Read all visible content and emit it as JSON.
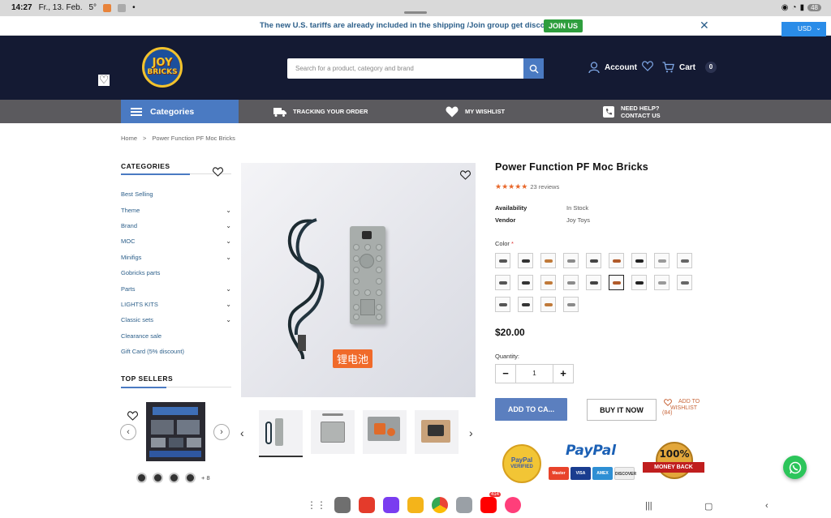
{
  "status_bar": {
    "time": "14:27",
    "date": "Fr., 13. Feb.",
    "temperature": "5°",
    "battery": "48"
  },
  "promo": {
    "text": "The new U.S. tariffs are already included in the shipping /Join group get discount",
    "join_label": "JOIN US",
    "close_icon": "close-icon"
  },
  "currency": {
    "selected": "USD"
  },
  "header": {
    "logo_line1": "JOY",
    "logo_line2": "BRICKS",
    "search_placeholder": "Search for a product, category and brand",
    "account_label": "Account",
    "cart_label": "Cart",
    "cart_count": "0"
  },
  "nav": {
    "categories_label": "Categories",
    "tracking_label": "TRACKING YOUR ORDER",
    "wishlist_label": "MY WISHLIST",
    "help_line1": "NEED HELP?",
    "help_line2": "CONTACT US"
  },
  "breadcrumb": {
    "home": "Home",
    "separator": ">",
    "current": "Power Function PF Moc Bricks"
  },
  "sidebar": {
    "categories_title": "CATEGORIES",
    "items": [
      {
        "label": "Best Selling",
        "expandable": false
      },
      {
        "label": "Theme",
        "expandable": true
      },
      {
        "label": "Brand",
        "expandable": true
      },
      {
        "label": "MOC",
        "expandable": true
      },
      {
        "label": "Minifigs",
        "expandable": true
      },
      {
        "label": "Gobricks parts",
        "expandable": false
      },
      {
        "label": "Parts",
        "expandable": true
      },
      {
        "label": "LIGHTS KITS",
        "expandable": true
      },
      {
        "label": "Classic sets",
        "expandable": true
      },
      {
        "label": "Clearance sale",
        "expandable": false
      },
      {
        "label": "Gift Card (5% discount)",
        "expandable": false
      }
    ],
    "top_sellers_title": "TOP SELLERS",
    "more_swatches": "+ 8"
  },
  "gallery": {
    "image_label": "锂电池",
    "thumb_prev": "‹",
    "thumb_next": "›"
  },
  "product": {
    "title": "Power Function PF Moc Bricks",
    "rating": 4.5,
    "stars": "★★★★★",
    "reviews": "23 reviews",
    "availability_label": "Availability",
    "availability_value": "In Stock",
    "vendor_label": "Vendor",
    "vendor_value": "Joy Toys",
    "color_label": "Color",
    "required_mark": "*",
    "swatch_count": 22,
    "selected_swatch_index": 14,
    "price": "$20.00",
    "quantity_label": "Quantity:",
    "quantity_value": "1",
    "minus": "−",
    "plus": "+",
    "add_to_cart": "ADD TO CA...",
    "buy_now": "BUY IT NOW",
    "wishlist_line1": "ADD TO",
    "wishlist_line2": "WISHLIST",
    "wishlist_count": "(84)"
  },
  "trust": {
    "seal_line1": "PayPal",
    "seal_line2": "VERIFIED",
    "paypal": "PayPal",
    "cards": [
      "Master",
      "VISA",
      "AMEX",
      "DISCOVER"
    ],
    "money_back_pct": "100%",
    "money_back_text": "MONEY BACK"
  },
  "colors": {
    "accent": "#4a7ac2",
    "header_bg": "#141a33",
    "nav_bg": "#5b5a5e",
    "star": "#e8672a",
    "join": "#2e9e3e",
    "whatsapp": "#2cc55a"
  },
  "dock": {
    "badge": "414"
  }
}
